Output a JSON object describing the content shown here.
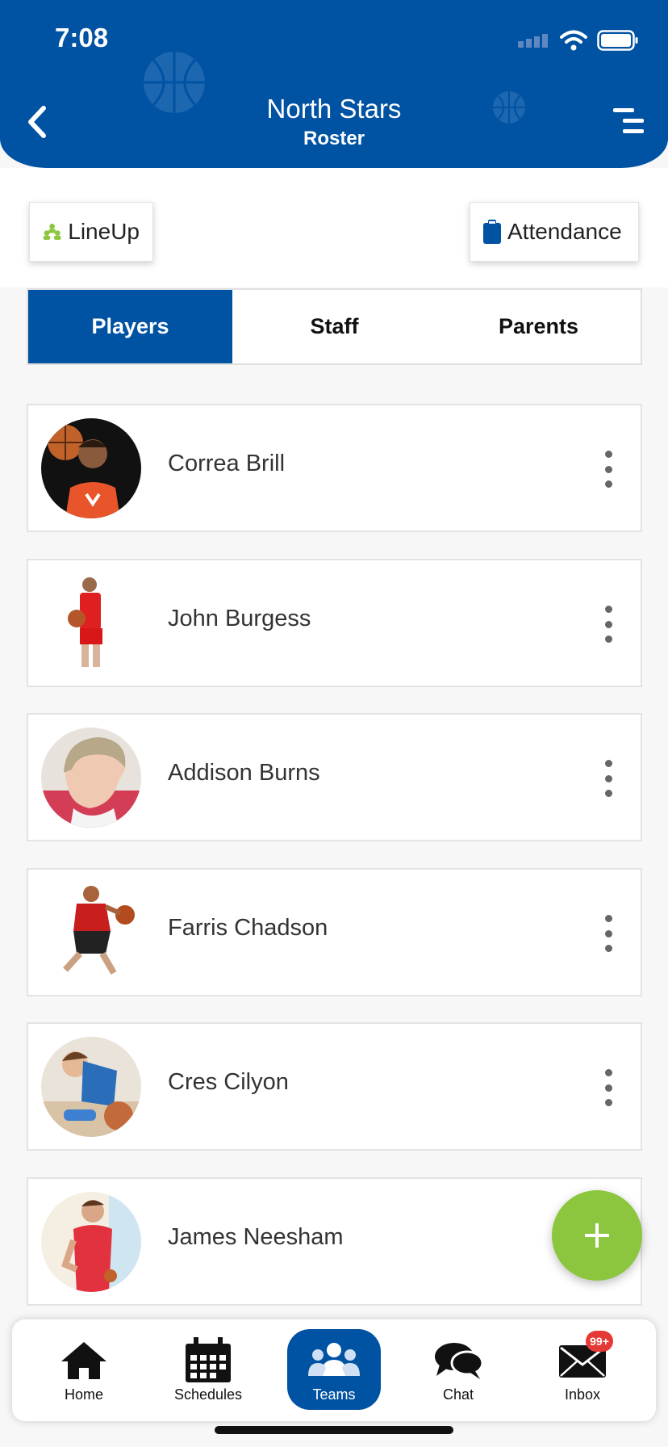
{
  "status_bar": {
    "time": "7:08"
  },
  "header": {
    "team_name": "North Stars",
    "page_title": "Roster"
  },
  "actions": {
    "lineup_label": "LineUp",
    "attendance_label": "Attendance"
  },
  "tabs": [
    {
      "label": "Players",
      "active": true
    },
    {
      "label": "Staff",
      "active": false
    },
    {
      "label": "Parents",
      "active": false
    }
  ],
  "players": [
    {
      "name": "Correa Brill"
    },
    {
      "name": "John Burgess"
    },
    {
      "name": "Addison Burns"
    },
    {
      "name": "Farris Chadson"
    },
    {
      "name": "Cres Cilyon"
    },
    {
      "name": "James Neesham"
    }
  ],
  "bottom_nav": {
    "items": [
      {
        "label": "Home",
        "icon": "home-icon"
      },
      {
        "label": "Schedules",
        "icon": "calendar-icon"
      },
      {
        "label": "Teams",
        "icon": "teams-icon",
        "active": true
      },
      {
        "label": "Chat",
        "icon": "chat-icon"
      },
      {
        "label": "Inbox",
        "icon": "mail-icon",
        "badge": "99+"
      }
    ]
  },
  "colors": {
    "primary": "#0052a3",
    "accent": "#8cc63f",
    "badge": "#e53935"
  }
}
